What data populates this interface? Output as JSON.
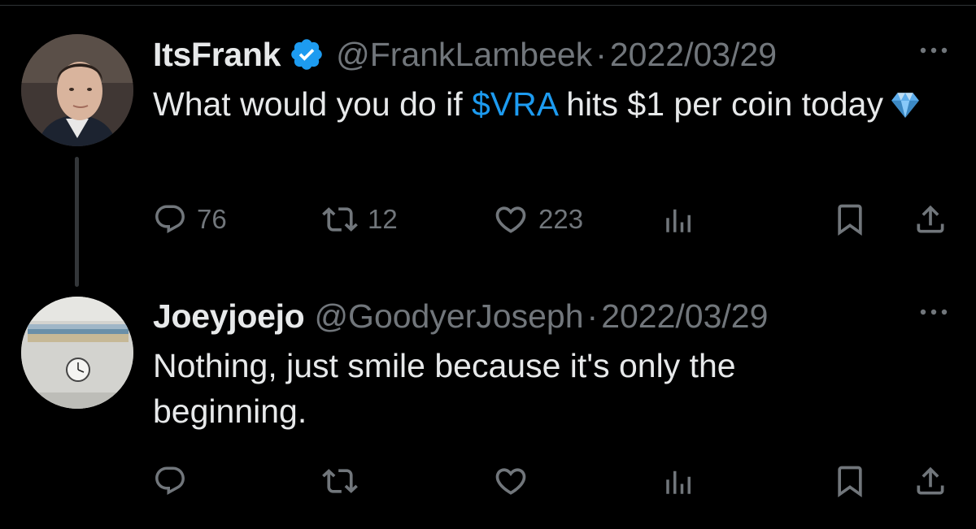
{
  "tweets": [
    {
      "display_name": "ItsFrank",
      "verified": true,
      "handle": "@FrankLambeek",
      "separator": "·",
      "date": "2022/03/29",
      "text_before": "What would you do if ",
      "cashtag": "$VRA",
      "text_after": " hits $1 per coin today",
      "emoji": "gem-stone",
      "counts": {
        "replies": "76",
        "retweets": "12",
        "likes": "223"
      }
    },
    {
      "display_name": "Joeyjoejo",
      "verified": false,
      "handle": "@GoodyerJoseph",
      "separator": "·",
      "date": "2022/03/29",
      "text": "Nothing, just smile because it's only the beginning.",
      "counts": {
        "replies": "",
        "retweets": "",
        "likes": ""
      }
    }
  ],
  "icons": {
    "reply": "reply-icon",
    "retweet": "retweet-icon",
    "like": "like-icon",
    "views": "views-icon",
    "bookmark": "bookmark-icon",
    "share": "share-icon",
    "more": "more-icon",
    "verified": "verified-badge-icon"
  },
  "colors": {
    "background": "#000000",
    "text": "#e7e9ea",
    "secondary": "#71767b",
    "accent": "#1d9bf0"
  }
}
